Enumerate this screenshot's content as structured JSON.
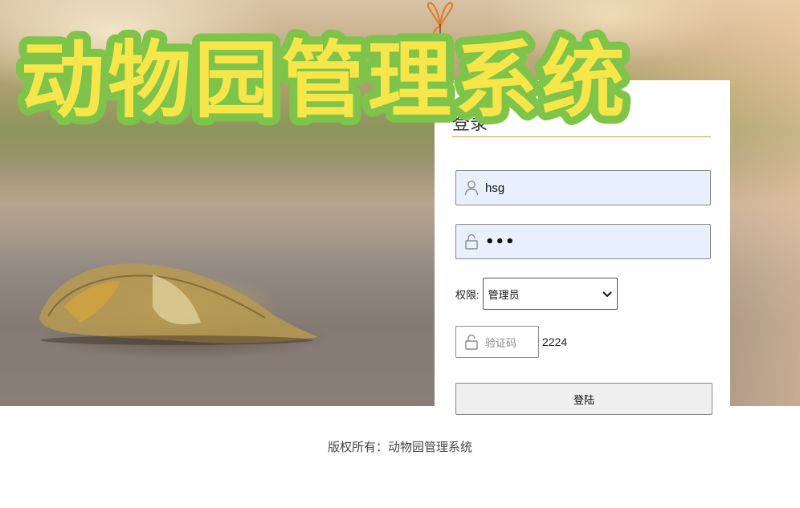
{
  "title": "动物园管理系统",
  "login": {
    "heading": "登录",
    "username": "hsg",
    "password_mask": "•••",
    "permission_label": "权限:",
    "permission_selected": "管理员",
    "captcha_placeholder": "验证码",
    "captcha_code": "2224",
    "submit_label": "登陆"
  },
  "footer": {
    "copyright": "版权所有：动物园管理系统"
  },
  "colors": {
    "title_fill": "#f6e64a",
    "title_outline": "#7ec34a",
    "field_bg": "#e8f0fe",
    "heading_underline": "#c9a24b"
  },
  "icons": {
    "user_field": "user-icon",
    "password_field": "lock-icon",
    "captcha_field": "lock-icon",
    "select_arrow": "chevron-down-icon",
    "butterfly": "butterfly-icon"
  }
}
